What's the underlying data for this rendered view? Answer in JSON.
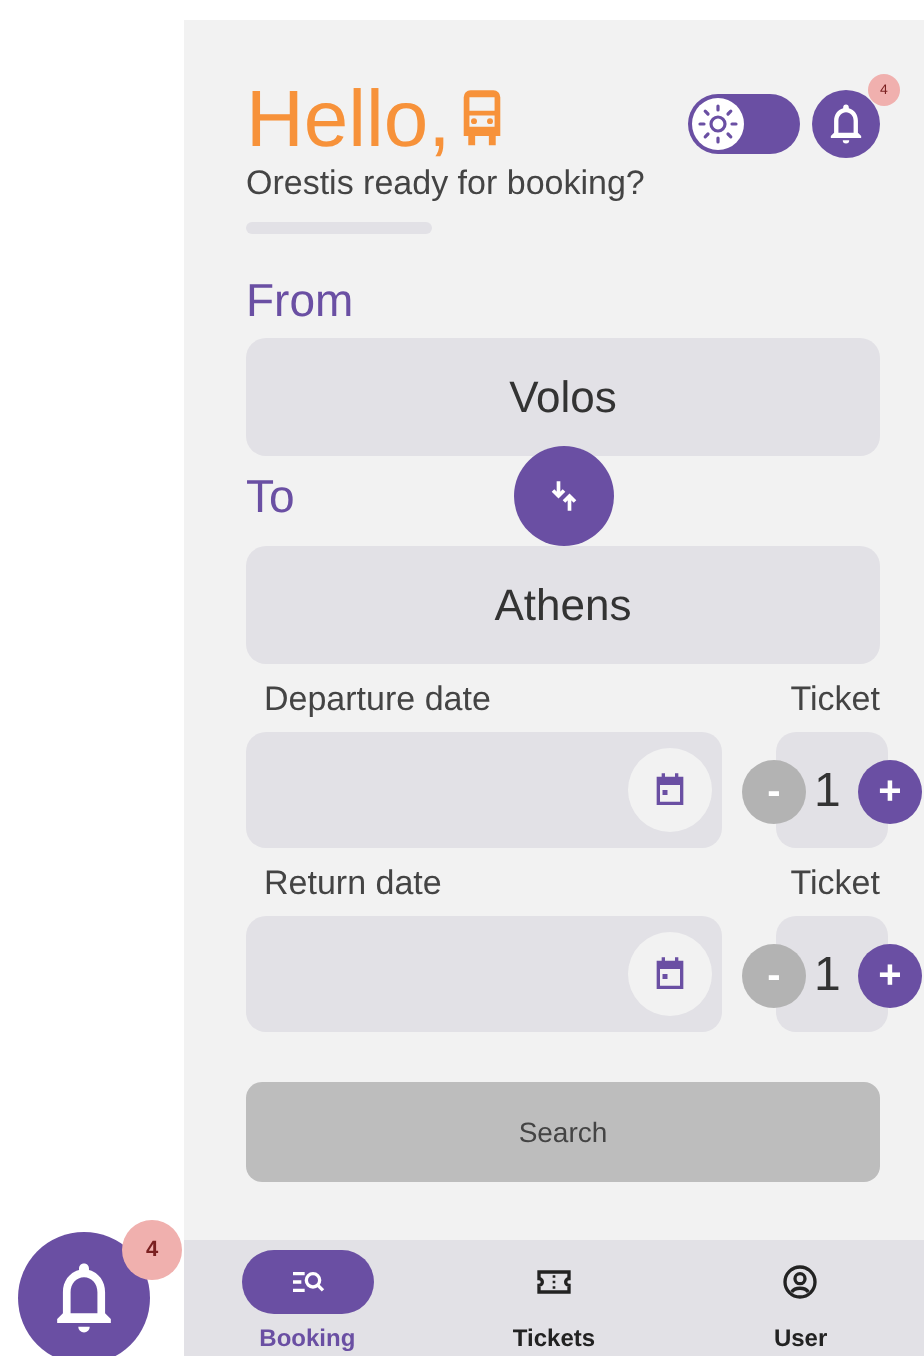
{
  "header": {
    "greeting": "Hello,",
    "subtitle": "Orestis ready for booking?",
    "theme_toggle": {
      "on": true
    },
    "notifications": {
      "badge": "4"
    }
  },
  "route": {
    "from": {
      "label": "From",
      "value": "Volos"
    },
    "to": {
      "label": "To",
      "value": "Athens"
    }
  },
  "trips": [
    {
      "date_label": "Departure date",
      "ticket_label": "Ticket",
      "count": "1",
      "minus": "-",
      "plus": "+"
    },
    {
      "date_label": "Return date",
      "ticket_label": "Ticket",
      "count": "1",
      "minus": "-",
      "plus": "+"
    }
  ],
  "search_button": {
    "label": "Search",
    "disabled": true
  },
  "nav": [
    {
      "label": "Booking",
      "kind": "search",
      "selected": true
    },
    {
      "label": "Tickets",
      "kind": "ticket",
      "selected": false
    },
    {
      "label": "User",
      "kind": "user",
      "selected": false
    }
  ],
  "floating_notifications": {
    "badge": "4"
  }
}
